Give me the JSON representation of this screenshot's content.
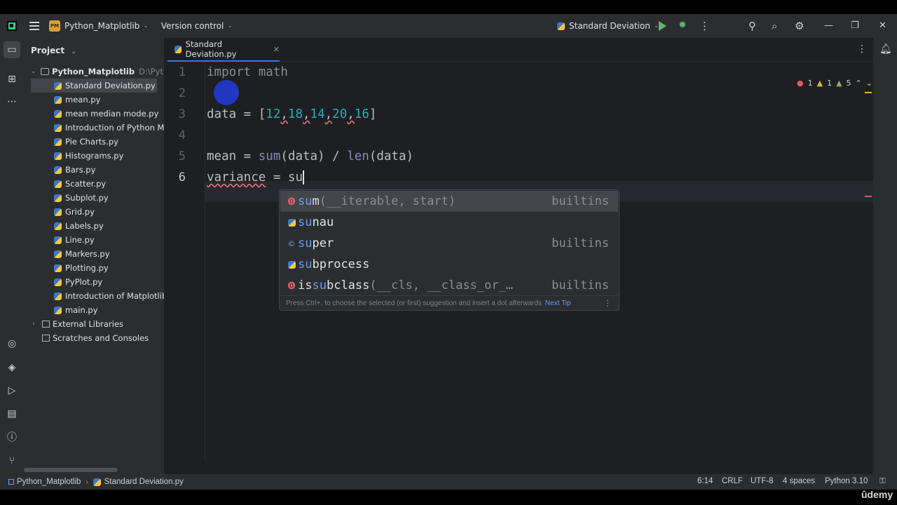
{
  "titlebar": {
    "project_badge": "PM",
    "project_name": "Python_Matplotlib",
    "vcs_label": "Version control",
    "run_config": "Standard Deviation"
  },
  "project_panel": {
    "title": "Project",
    "root": {
      "name": "Python_Matplotlib",
      "path": "D:\\Pythor"
    },
    "files": [
      "Standard Deviation.py",
      "mean.py",
      "mean median mode.py",
      "Introduction of Python Mac",
      "Pie Charts.py",
      "Histograms.py",
      "Bars.py",
      "Scatter.py",
      "Subplot.py",
      "Grid.py",
      "Labels.py",
      "Line.py",
      "Markers.py",
      "Plotting.py",
      "PyPlot.py",
      "Introduction of Matplotlib.p",
      "main.py"
    ],
    "external_libraries": "External Libraries",
    "scratches": "Scratches and Consoles"
  },
  "editor": {
    "tab_label": "Standard Deviation.py",
    "line_numbers": [
      "1",
      "2",
      "3",
      "4",
      "5",
      "6"
    ],
    "line1": {
      "kw_a": "imp",
      "kw_b": "ort",
      "rest": " math"
    },
    "line3": {
      "prefix": "data = [",
      "n1": "12",
      "n2": "18",
      "n3": "14",
      "n4": "20",
      "n5": "16",
      "comma": ",",
      "suffix": "]"
    },
    "line5": {
      "a": "mean = ",
      "fn1": "sum",
      "b": "(data) / ",
      "fn2": "len",
      "c": "(data)"
    },
    "line6": {
      "var": "variance",
      "rest": " = su"
    },
    "inspections": {
      "errors": "1",
      "warnings": "1",
      "weak_warnings": "5"
    }
  },
  "completion": {
    "items": [
      {
        "hl": "su",
        "rest": "m",
        "tail": "(__iterable, start)",
        "source": "builtins"
      },
      {
        "hl": "su",
        "rest": "nau",
        "tail": "",
        "source": ""
      },
      {
        "hl": "su",
        "rest": "per",
        "tail": "",
        "source": "builtins"
      },
      {
        "hl": "su",
        "rest": "bprocess",
        "tail": "",
        "source": ""
      },
      {
        "pre": "is",
        "hl": "su",
        "rest": "bclass",
        "tail": "(__cls, __class_or_…",
        "source": "builtins"
      }
    ],
    "footer_text": "Press Ctrl+. to choose the selected (or first) suggestion and insert a dot afterwards",
    "footer_link": "Next Tip"
  },
  "statusbar": {
    "crumb_project": "Python_Matplotlib",
    "crumb_file": "Standard Deviation.py",
    "position": "6:14",
    "line_sep": "CRLF",
    "encoding": "UTF-8",
    "indent": "4 spaces",
    "interpreter": "Python 3.10"
  },
  "watermark": "ûdemy",
  "colors": {
    "accent": "#3574f0",
    "number": "#2aacb8",
    "keyword": "#cf8e6d",
    "builtin": "#8888c6",
    "error": "#e55765"
  }
}
